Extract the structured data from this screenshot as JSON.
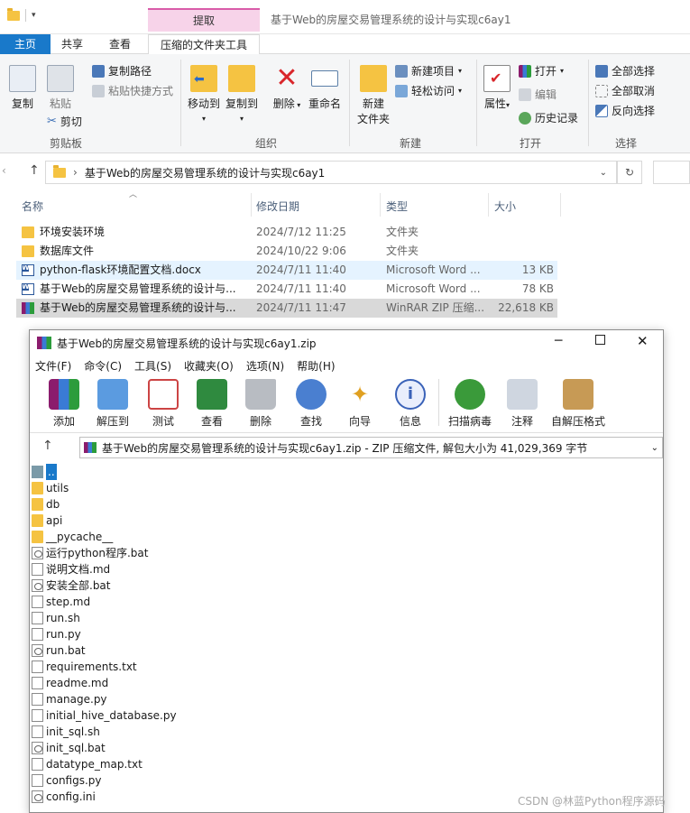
{
  "explorer": {
    "context_tab": "提取",
    "window_title": "基于Web的房屋交易管理系统的设计与实现c6ay1",
    "tabs": [
      "主页",
      "共享",
      "查看",
      "压缩的文件夹工具"
    ],
    "clipboard": {
      "label": "剪贴板",
      "copy": "复制",
      "paste": "粘贴",
      "copy_path": "复制路径",
      "paste_shortcut": "粘贴快捷方式",
      "cut": "剪切"
    },
    "organize": {
      "label": "组织",
      "move_to": "移动到",
      "copy_to": "复制到",
      "delete": "删除",
      "rename": "重命名"
    },
    "new": {
      "label": "新建",
      "new_folder": "新建\n文件夹",
      "new_folder_l1": "新建",
      "new_folder_l2": "文件夹",
      "new_item": "新建项目",
      "easy_access": "轻松访问"
    },
    "open": {
      "label": "打开",
      "properties": "属性",
      "open": "打开",
      "edit": "编辑",
      "history": "历史记录"
    },
    "select": {
      "label": "选择",
      "select_all": "全部选择",
      "select_none": "全部取消",
      "invert": "反向选择"
    },
    "address": "基于Web的房屋交易管理系统的设计与实现c6ay1",
    "columns": [
      "名称",
      "修改日期",
      "类型",
      "大小"
    ],
    "files": [
      {
        "name": "环境安装环境",
        "date": "2024/7/12 11:25",
        "type": "文件夹",
        "size": "",
        "icon": "folder"
      },
      {
        "name": "数据库文件",
        "date": "2024/10/22 9:06",
        "type": "文件夹",
        "size": "",
        "icon": "folder"
      },
      {
        "name": "python-flask环境配置文档.docx",
        "date": "2024/7/11 11:40",
        "type": "Microsoft Word ...",
        "size": "13 KB",
        "icon": "word"
      },
      {
        "name": "基于Web的房屋交易管理系统的设计与...",
        "date": "2024/7/11 11:40",
        "type": "Microsoft Word ...",
        "size": "78 KB",
        "icon": "word"
      },
      {
        "name": "基于Web的房屋交易管理系统的设计与...",
        "date": "2024/7/11 11:47",
        "type": "WinRAR ZIP 压缩...",
        "size": "22,618 KB",
        "icon": "rar"
      }
    ]
  },
  "winrar": {
    "title": "基于Web的房屋交易管理系统的设计与实现c6ay1.zip",
    "menu": [
      "文件(F)",
      "命令(C)",
      "工具(S)",
      "收藏夹(O)",
      "选项(N)",
      "帮助(H)"
    ],
    "tools": [
      "添加",
      "解压到",
      "测试",
      "查看",
      "删除",
      "查找",
      "向导",
      "信息",
      "扫描病毒",
      "注释",
      "自解压格式"
    ],
    "path_text": "基于Web的房屋交易管理系统的设计与实现c6ay1.zip - ZIP 压缩文件, 解包大小为 41,029,369 字节",
    "entries": [
      {
        "name": "..",
        "icon": "up"
      },
      {
        "name": "utils",
        "icon": "fold"
      },
      {
        "name": "db",
        "icon": "fold"
      },
      {
        "name": "api",
        "icon": "fold"
      },
      {
        "name": "__pycache__",
        "icon": "fold"
      },
      {
        "name": "运行python程序.bat",
        "icon": "bat"
      },
      {
        "name": "说明文档.md",
        "icon": "doc"
      },
      {
        "name": "安装全部.bat",
        "icon": "bat"
      },
      {
        "name": "step.md",
        "icon": "doc"
      },
      {
        "name": "run.sh",
        "icon": "doc"
      },
      {
        "name": "run.py",
        "icon": "doc"
      },
      {
        "name": "run.bat",
        "icon": "bat"
      },
      {
        "name": "requirements.txt",
        "icon": "doc"
      },
      {
        "name": "readme.md",
        "icon": "doc"
      },
      {
        "name": "manage.py",
        "icon": "doc"
      },
      {
        "name": "initial_hive_database.py",
        "icon": "doc"
      },
      {
        "name": "init_sql.sh",
        "icon": "doc"
      },
      {
        "name": "init_sql.bat",
        "icon": "bat"
      },
      {
        "name": "datatype_map.txt",
        "icon": "doc"
      },
      {
        "name": "configs.py",
        "icon": "doc"
      },
      {
        "name": "config.ini",
        "icon": "bat"
      }
    ]
  },
  "watermark": "CSDN @林蓝Python程序源码",
  "colors": {
    "accent": "#1979ca",
    "context_tab": "#f7d3e9",
    "folder": "#f5c342",
    "selected_row": "#d9d9d9",
    "hover_row": "#e5f3ff"
  }
}
